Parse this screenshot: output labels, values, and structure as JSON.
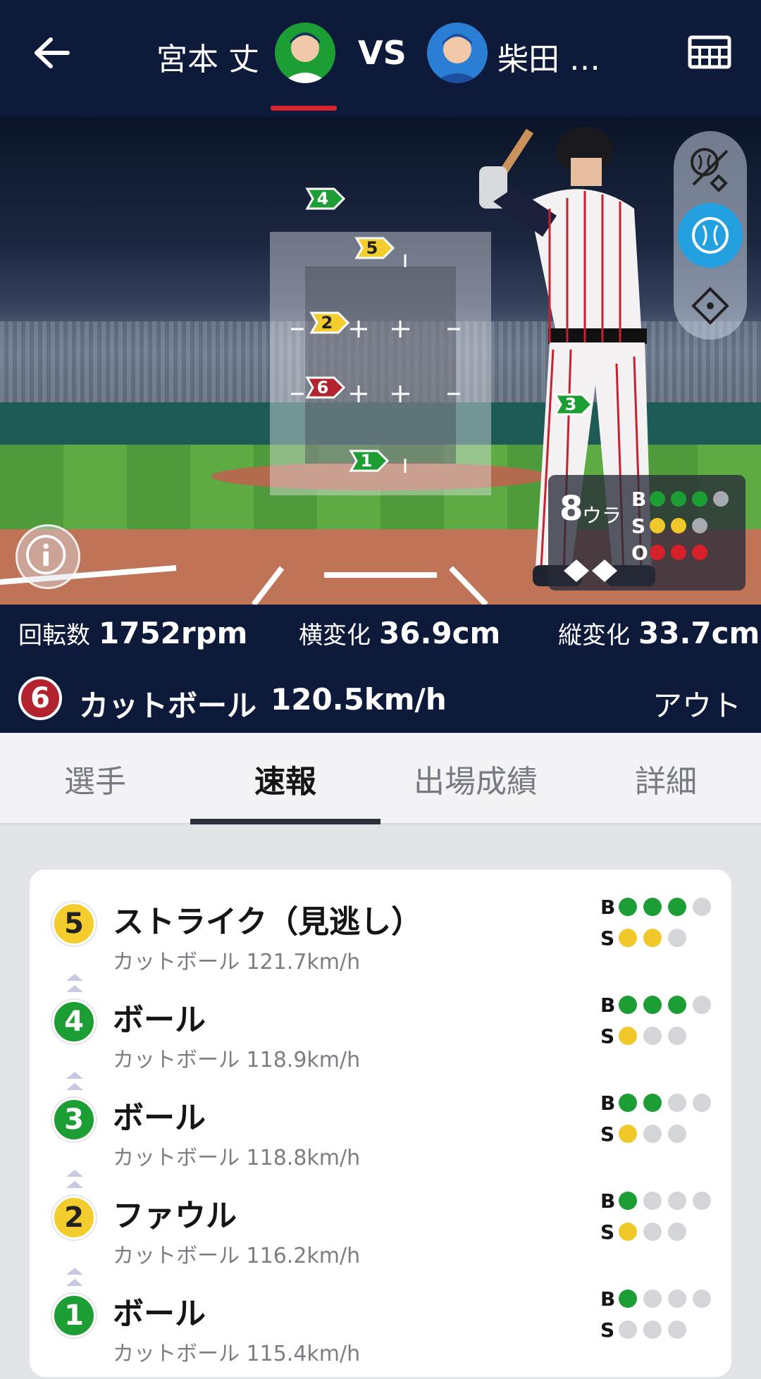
{
  "header": {
    "pitcher_name": "宮本 丈",
    "vs_label": "VS",
    "batter_name": "柴田 …"
  },
  "field": {
    "pitch_markers": [
      {
        "num": "4",
        "color": "green"
      },
      {
        "num": "5",
        "color": "yellow"
      },
      {
        "num": "2",
        "color": "yellow"
      },
      {
        "num": "6",
        "color": "red"
      },
      {
        "num": "3",
        "color": "green"
      },
      {
        "num": "1",
        "color": "green"
      }
    ],
    "count": {
      "inning": "8",
      "inning_half": "ウラ",
      "b_label": "B",
      "s_label": "S",
      "o_label": "O",
      "balls": 3,
      "strikes": 2,
      "outs": 3
    }
  },
  "pitch_info": {
    "spin_label": "回転数",
    "spin_value": "1752rpm",
    "hbreak_label": "横変化",
    "hbreak_value": "36.9cm",
    "vbreak_label": "縦変化",
    "vbreak_value": "33.7cm",
    "pitch_num": "6",
    "pitch_type": "カットボール",
    "pitch_speed": "120.5km/h",
    "result": "アウト"
  },
  "tabs": [
    {
      "label": "選手"
    },
    {
      "label": "速報"
    },
    {
      "label": "出場成績"
    },
    {
      "label": "詳細"
    }
  ],
  "pitch_log": [
    {
      "num": "5",
      "color": "yellow",
      "result": "ストライク（見逃し）",
      "detail": "カットボール 121.7km/h",
      "balls": 3,
      "strikes": 2
    },
    {
      "num": "4",
      "color": "green",
      "result": "ボール",
      "detail": "カットボール 118.9km/h",
      "balls": 3,
      "strikes": 1
    },
    {
      "num": "3",
      "color": "green",
      "result": "ボール",
      "detail": "カットボール 118.8km/h",
      "balls": 2,
      "strikes": 1
    },
    {
      "num": "2",
      "color": "yellow",
      "result": "ファウル",
      "detail": "カットボール 116.2km/h",
      "balls": 1,
      "strikes": 1
    },
    {
      "num": "1",
      "color": "green",
      "result": "ボール",
      "detail": "カットボール 115.4km/h",
      "balls": 1,
      "strikes": 0
    }
  ],
  "colors": {
    "header_bg": "#0e1a3a",
    "accent_red": "#d8252f",
    "ball_green": "#1d9e34",
    "strike_yellow": "#f1c82a",
    "out_red": "#d6202a",
    "active_tool": "#22a0e0"
  },
  "icons": {
    "back": "arrow-left-icon",
    "scoreboard": "scoreboard-icon",
    "tool1": "pitch-type-icon",
    "tool2": "baseball-icon",
    "tool3": "diamond-icon",
    "info": "info-icon"
  }
}
